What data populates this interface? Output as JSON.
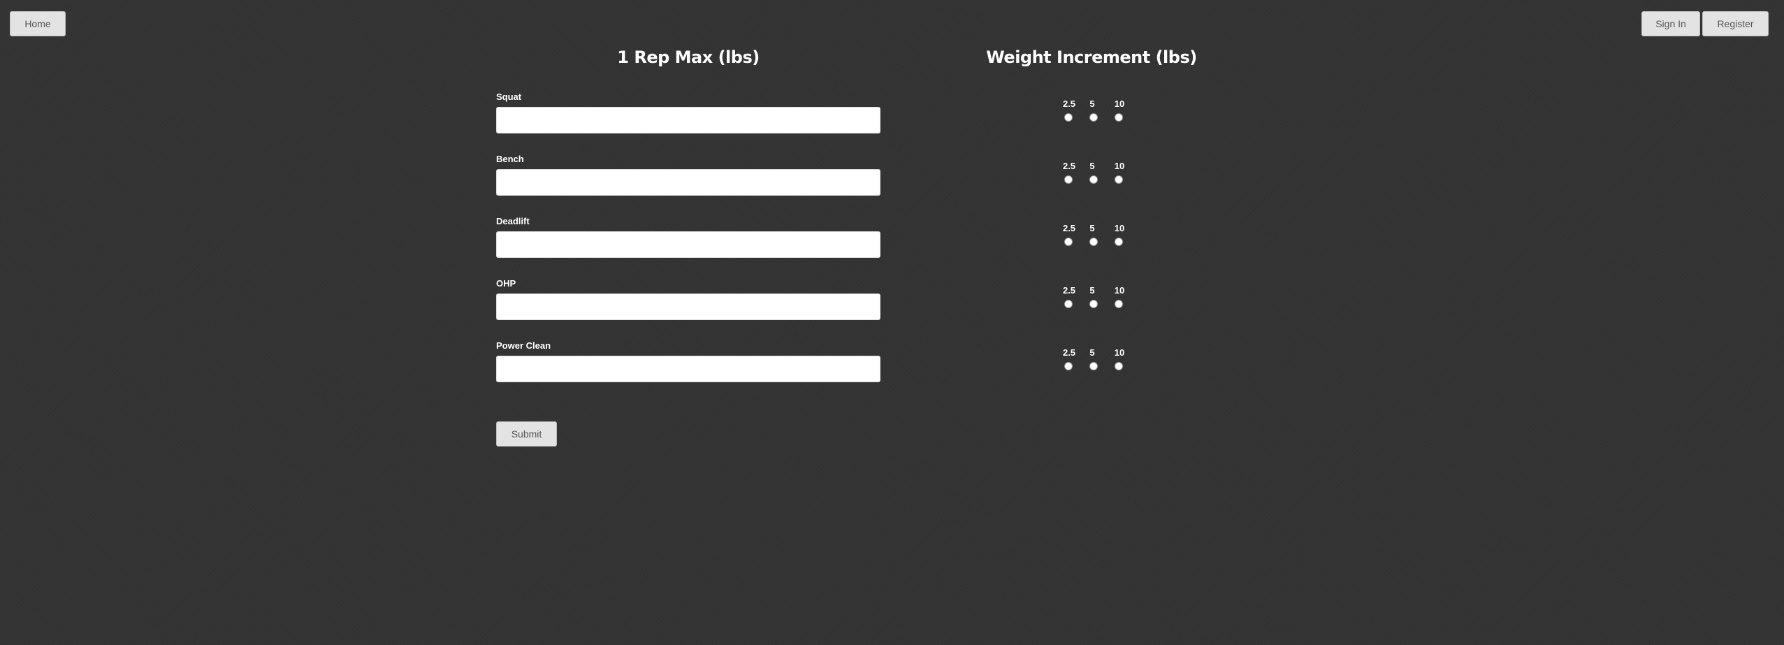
{
  "nav": {
    "home_label": "Home",
    "sign_in_label": "Sign In",
    "register_label": "Register"
  },
  "rep_max": {
    "heading": "1 Rep Max (lbs)",
    "fields": [
      {
        "label": "Squat",
        "value": ""
      },
      {
        "label": "Bench",
        "value": ""
      },
      {
        "label": "Deadlift",
        "value": ""
      },
      {
        "label": "OHP",
        "value": ""
      },
      {
        "label": "Power Clean",
        "value": ""
      }
    ]
  },
  "increment": {
    "heading": "Weight Increment (lbs)",
    "options": [
      "2.5",
      "5",
      "10"
    ]
  },
  "form": {
    "submit_label": "Submit"
  }
}
